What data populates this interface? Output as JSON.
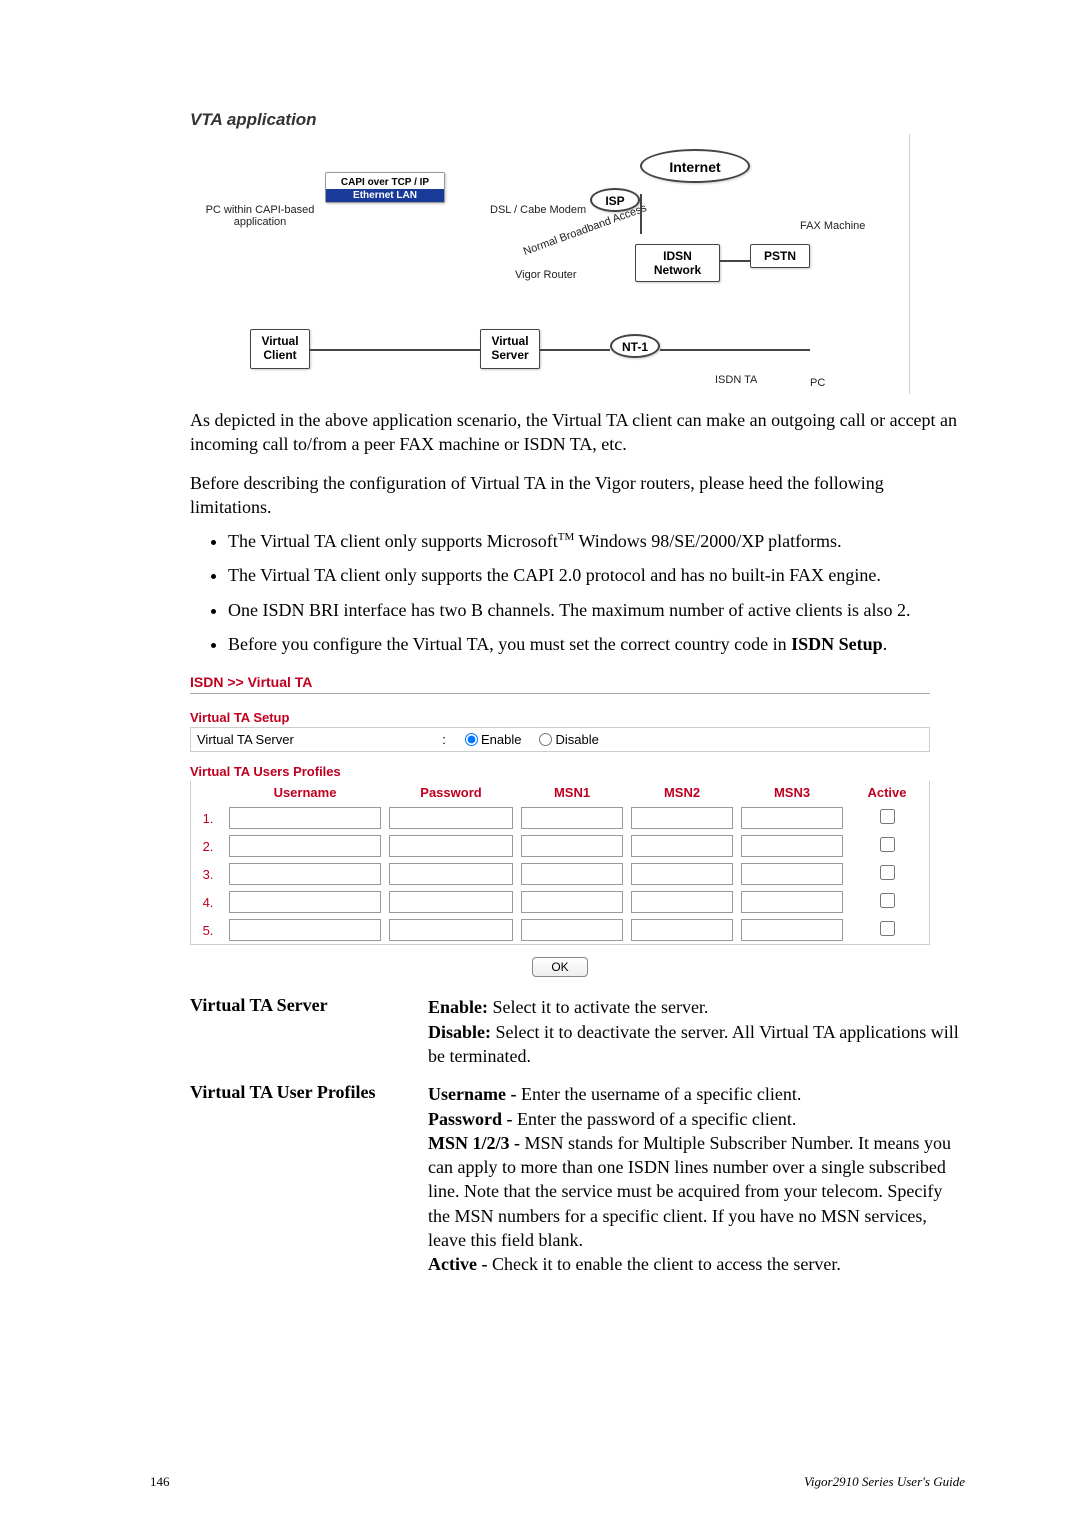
{
  "vta": {
    "title": "VTA application",
    "nodes": {
      "capi": "CAPI over TCP / IP",
      "ethernet": "Ethernet LAN",
      "pc_app": "PC within CAPI-based application",
      "dsl": "DSL / Cabe Modem",
      "broadband": "Normal Broadband Access",
      "internet": "Internet",
      "isp": "ISP",
      "idsn": "IDSN Network",
      "pstn": "PSTN",
      "fax": "FAX Machine",
      "vrouter": "Vigor Router",
      "vclient1": "Virtual",
      "vclient2": "Client",
      "vserver1": "Virtual",
      "vserver2": "Server",
      "nt1": "NT-1",
      "isdnta": "ISDN TA",
      "pc": "PC"
    }
  },
  "para1": "As depicted in the above application scenario, the Virtual TA client can make an outgoing call or accept an incoming call to/from a peer FAX machine or ISDN TA, etc.",
  "para2": "Before describing the configuration of Virtual TA in the Vigor routers, please heed the following limitations.",
  "bullets": [
    {
      "pre": "The Virtual TA client only supports Microsoft",
      "sup": "TM",
      "post": " Windows 98/SE/2000/XP platforms."
    },
    {
      "pre": "The Virtual TA client only supports the CAPI 2.0 protocol and has no built-in FAX engine.",
      "sup": "",
      "post": ""
    },
    {
      "pre": "One ISDN BRI interface has two B channels. The maximum number of active clients is also 2.",
      "sup": "",
      "post": ""
    },
    {
      "pre": "Before you configure the Virtual TA, you must set the correct country code in ",
      "sup": "",
      "post": "",
      "bold_tail": "ISDN Setup",
      "tail": "."
    }
  ],
  "crumb": {
    "a": "ISDN",
    "sep": ">>",
    "b": "Virtual TA"
  },
  "setup": {
    "h": "Virtual TA Setup",
    "server_label": "Virtual TA Server",
    "enable": "Enable",
    "disable": "Disable"
  },
  "profiles": {
    "h": "Virtual TA Users Profiles",
    "head": {
      "user": "Username",
      "pass": "Password",
      "m1": "MSN1",
      "m2": "MSN2",
      "m3": "MSN3",
      "active": "Active"
    },
    "rows": [
      "1.",
      "2.",
      "3.",
      "4.",
      "5."
    ]
  },
  "ok": "OK",
  "defs": [
    {
      "term": "Virtual TA Server",
      "lines": [
        {
          "b": "Enable:",
          "t": " Select it to activate the server."
        },
        {
          "b": "Disable:",
          "t": " Select it to deactivate the server. All Virtual TA applications will be terminated."
        }
      ]
    },
    {
      "term": "Virtual TA User Profiles",
      "lines": [
        {
          "b": "Username -",
          "t": " Enter the username of a specific client."
        },
        {
          "b": "Password -",
          "t": " Enter the password of a specific client."
        },
        {
          "b": "MSN 1/2/3 -",
          "t": " MSN stands for Multiple Subscriber Number.   It means you can apply to more than one ISDN lines number over a single subscribed line. Note that the service must be acquired from your telecom. Specify the MSN numbers for a specific client. If you have no MSN services, leave this field blank."
        },
        {
          "b": "Active -",
          "t": " Check it to enable the client to access the server."
        }
      ]
    }
  ],
  "footer": {
    "page": "146",
    "guide": "Vigor2910  Series  User's Guide"
  }
}
